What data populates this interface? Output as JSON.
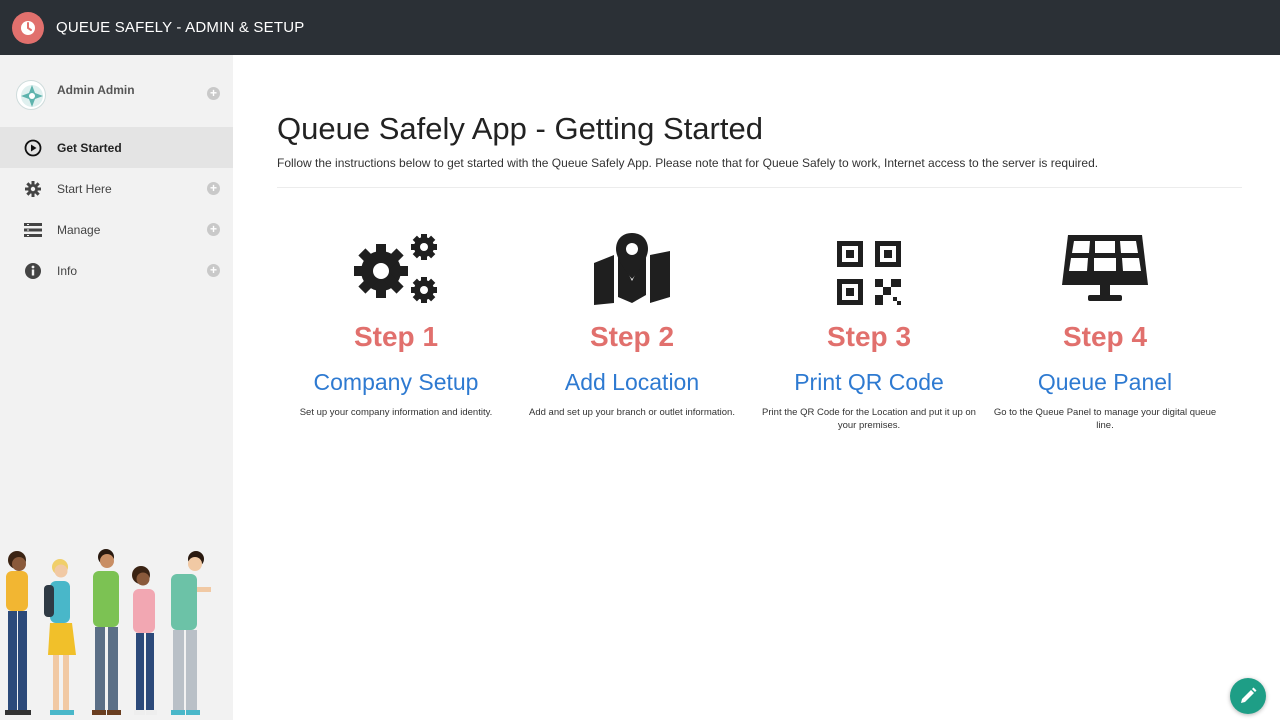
{
  "header": {
    "title": "QUEUE SAFELY - ADMIN & SETUP"
  },
  "sidebar": {
    "user_name": "Admin Admin",
    "items": [
      {
        "label": "Get Started",
        "icon": "play-circle-icon",
        "active": true
      },
      {
        "label": "Start Here",
        "icon": "gear-icon",
        "active": false
      },
      {
        "label": "Manage",
        "icon": "list-icon",
        "active": false
      },
      {
        "label": "Info",
        "icon": "info-icon",
        "active": false
      }
    ]
  },
  "main": {
    "title": "Queue Safely App - Getting Started",
    "description": "Follow the instructions below to get started with the Queue Safely App. Please note that for Queue Safely to work, Internet access to the server is required.",
    "steps": [
      {
        "number": "Step 1",
        "name": "Company Setup",
        "description": "Set up your company information and identity.",
        "icon": "gears-icon"
      },
      {
        "number": "Step 2",
        "name": "Add Location",
        "description": "Add and set up your branch or outlet information.",
        "icon": "map-location-icon"
      },
      {
        "number": "Step 3",
        "name": "Print QR Code",
        "description": "Print the QR Code for the Location and put it up on your premises.",
        "icon": "qr-code-icon"
      },
      {
        "number": "Step 4",
        "name": "Queue Panel",
        "description": "Go to the Queue Panel to manage your digital queue line.",
        "icon": "display-panel-icon"
      }
    ]
  },
  "colors": {
    "topbar": "#2b3036",
    "accent_step": "#e1706d",
    "link_blue": "#2e7ad1",
    "fab": "#1e9e86"
  }
}
